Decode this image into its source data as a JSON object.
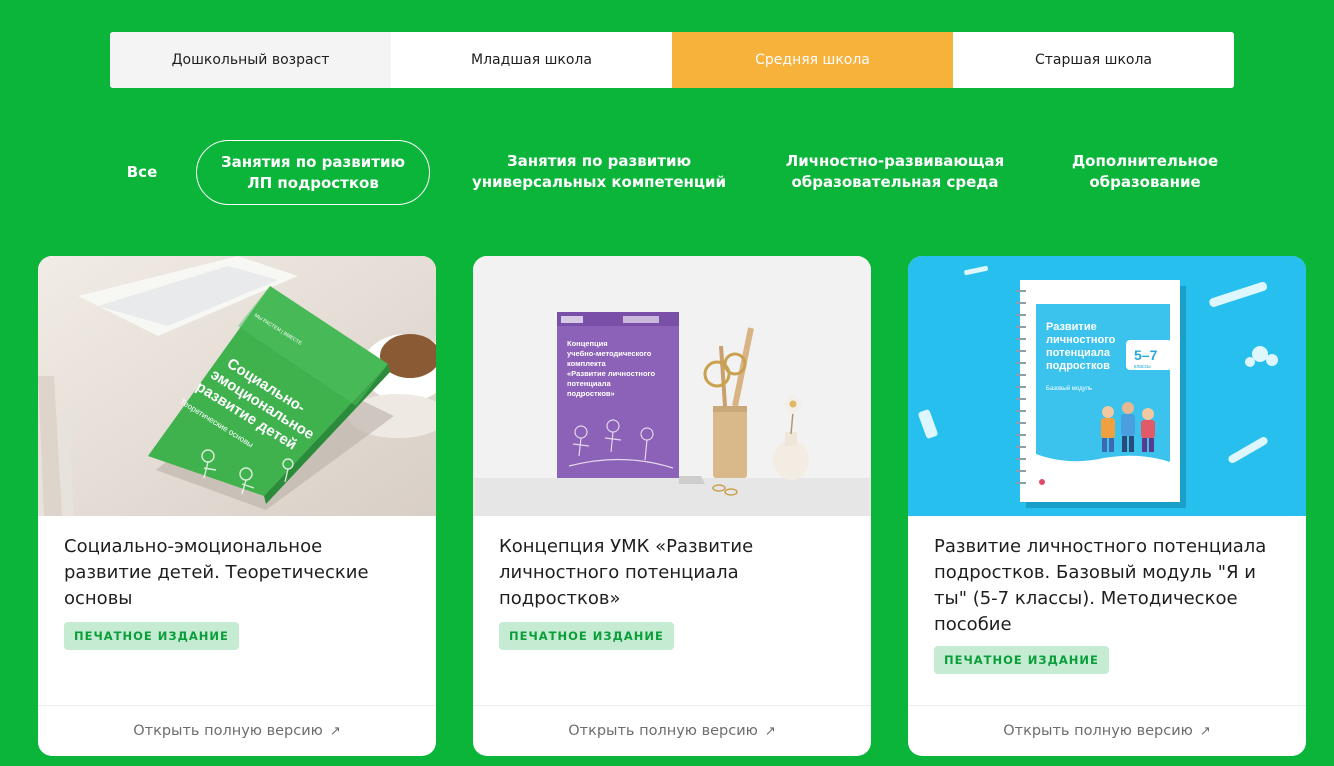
{
  "age_tabs": [
    {
      "label": "Дошкольный возраст"
    },
    {
      "label": "Младшая школа"
    },
    {
      "label": "Средняя школа"
    },
    {
      "label": "Старшая школа"
    }
  ],
  "age_tabs_active_index": 2,
  "filters": {
    "all": "Все",
    "items": [
      {
        "line1": "Занятия по развитию",
        "line2": "ЛП подростков"
      },
      {
        "line1": "Занятия по развитию",
        "line2": "универсальных компетенций"
      },
      {
        "line1": "Личностно-развивающая",
        "line2": "образовательная среда"
      },
      {
        "line1": "Дополнительное",
        "line2": "образование"
      }
    ]
  },
  "cards": [
    {
      "title": "Социально-эмоциональное развитие детей. Теоретические основы",
      "badge": "ПЕЧАТНОЕ ИЗДАНИЕ",
      "footer_link": "Открыть полную версию",
      "cover": {
        "series": "МЫ РАСТЕМ | ВМЕСТЕ",
        "line1": "Социально-",
        "line2": "эмоциональное",
        "line3": "развитие детей",
        "subtitle": "Теоретические основы"
      }
    },
    {
      "title": "Концепция УМК «Развитие личностного потенциала подростков»",
      "badge": "ПЕЧАТНОЕ ИЗДАНИЕ",
      "footer_link": "Открыть полную версию",
      "cover": {
        "line1": "Концепция",
        "line2": "учебно-методического",
        "line3": "комплекта",
        "line4": "«Развитие личностного",
        "line5": "потенциала",
        "line6": "подростков»"
      }
    },
    {
      "title": "Развитие личностного потенциала подростков. Базовый модуль \"Я и ты\" (5-7 классы). Методическое пособие",
      "badge": "ПЕЧАТНОЕ ИЗДАНИЕ",
      "footer_link": "Открыть полную версию",
      "cover": {
        "line1": "Развитие",
        "line2": "личностного",
        "line3": "потенциала",
        "line4": "подростков",
        "grade": "5–7",
        "grade_sub": "классы",
        "module": "Базовый модуль"
      }
    }
  ],
  "colors": {
    "background": "#0ab53a",
    "tab_active": "#f7b23b",
    "badge_bg": "#c5ecd2",
    "badge_text": "#0a9e3a"
  }
}
